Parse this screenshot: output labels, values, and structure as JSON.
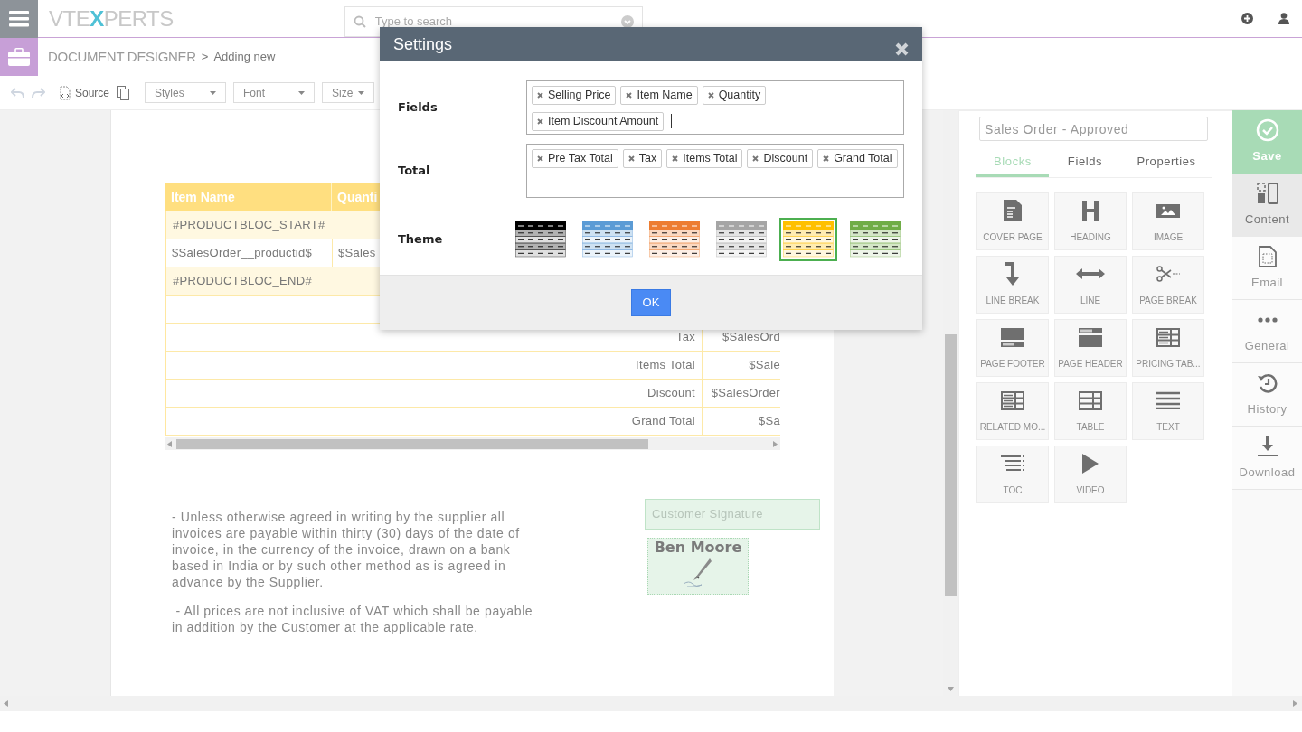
{
  "app_bar": {
    "logo": {
      "before": "VTE",
      "accent": "X",
      "after": "PERTS"
    },
    "search": {
      "placeholder": "Type to search"
    }
  },
  "breadcrumb": {
    "module": "DOCUMENT DESIGNER",
    "separator": ">",
    "page": "Adding new"
  },
  "toolbar": {
    "source": "Source",
    "dropdowns": [
      "Styles",
      "Font",
      "Size"
    ]
  },
  "document": {
    "table": {
      "columns": [
        "Item Name",
        "Quanti"
      ],
      "rows": [
        {
          "kind": "marker",
          "cells": [
            "#PRODUCTBLOC_START#"
          ]
        },
        {
          "kind": "data",
          "cells": [
            "$SalesOrder__productid$",
            "$Sales"
          ]
        },
        {
          "kind": "marker",
          "cells": [
            "#PRODUCTBLOC_END#"
          ]
        },
        {
          "kind": "blank"
        },
        {
          "kind": "total",
          "cells": [
            "Tax",
            "$SalesOrd"
          ]
        },
        {
          "kind": "total",
          "cells": [
            "Items Total",
            "$Sale"
          ]
        },
        {
          "kind": "total",
          "cells": [
            "Discount",
            "$SalesOrder"
          ]
        },
        {
          "kind": "total",
          "cells": [
            "Grand Total",
            "$Sa"
          ]
        }
      ]
    },
    "terms": [
      "- Unless otherwise agreed in writing by the supplier all invoices are payable within thirty (30) days of the date of invoice, in the currency of the invoice, drawn on a bank based in India or by such other method as is agreed in advance by the Supplier.",
      " - All prices are not inclusive of VAT which shall be payable in addition by the Customer at the applicable rate."
    ],
    "signature": {
      "label": "Customer Signature",
      "name": "Ben Moore"
    }
  },
  "panel": {
    "template_name": "Sales Order - Approved",
    "tabs": [
      {
        "label": "Blocks",
        "selected": true
      },
      {
        "label": "Fields",
        "selected": false
      },
      {
        "label": "Properties",
        "selected": false
      }
    ],
    "blocks": [
      "COVER PAGE",
      "HEADING",
      "IMAGE",
      "LINE BREAK",
      "LINE",
      "PAGE BREAK",
      "PAGE FOOTER",
      "PAGE HEADER",
      "PRICING TAB...",
      "RELATED MO...",
      "TABLE",
      "TEXT",
      "TOC",
      "VIDEO"
    ]
  },
  "nav": [
    {
      "label": "Save",
      "kind": "primary",
      "selected": false
    },
    {
      "label": "Content",
      "kind": "item",
      "selected": true
    },
    {
      "label": "Email",
      "kind": "item",
      "selected": false
    },
    {
      "label": "General",
      "kind": "item",
      "selected": false
    },
    {
      "label": "History",
      "kind": "item",
      "selected": false
    },
    {
      "label": "Download",
      "kind": "item",
      "selected": false
    }
  ],
  "dialog": {
    "title": "Settings",
    "fields": {
      "label": "Fields",
      "tags": [
        "Selling Price",
        "Item Name",
        "Quantity",
        "Item Discount Amount"
      ]
    },
    "total": {
      "label": "Total",
      "tags": [
        "Pre Tax Total",
        "Tax",
        "Items Total",
        "Discount",
        "Grand Total"
      ]
    },
    "theme": {
      "label": "Theme",
      "themes": [
        {
          "color": "#000000",
          "selected": false
        },
        {
          "color": "#5b9bd5",
          "selected": false
        },
        {
          "color": "#ed7d31",
          "selected": false
        },
        {
          "color": "#a5a5a5",
          "selected": false
        },
        {
          "color": "#ffc000",
          "selected": true
        },
        {
          "color": "#70ad47",
          "selected": false
        }
      ]
    },
    "ok": "OK"
  }
}
